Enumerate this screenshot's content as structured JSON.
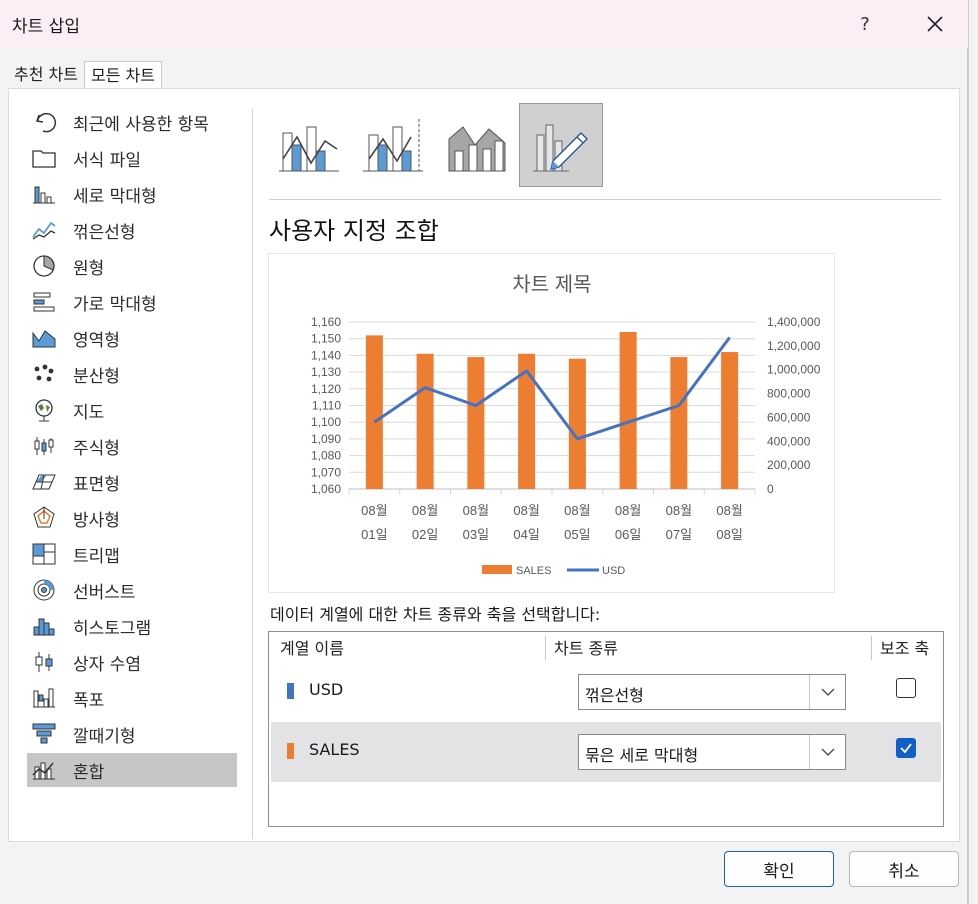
{
  "window": {
    "title": "차트 삽입",
    "help_label": "?"
  },
  "tabs": [
    {
      "label": "추천 차트"
    },
    {
      "label": "모든 차트"
    }
  ],
  "sidebar": {
    "items": [
      {
        "label": "최근에 사용한 항목",
        "icon": "recent-icon"
      },
      {
        "label": "서식 파일",
        "icon": "folder-icon"
      },
      {
        "label": "세로 막대형",
        "icon": "column-chart-icon"
      },
      {
        "label": "꺾은선형",
        "icon": "line-chart-icon"
      },
      {
        "label": "원형",
        "icon": "pie-chart-icon"
      },
      {
        "label": "가로 막대형",
        "icon": "bar-chart-icon"
      },
      {
        "label": "영역형",
        "icon": "area-chart-icon"
      },
      {
        "label": "분산형",
        "icon": "scatter-chart-icon"
      },
      {
        "label": "지도",
        "icon": "map-chart-icon"
      },
      {
        "label": "주식형",
        "icon": "stock-chart-icon"
      },
      {
        "label": "표면형",
        "icon": "surface-chart-icon"
      },
      {
        "label": "방사형",
        "icon": "radar-chart-icon"
      },
      {
        "label": "트리맵",
        "icon": "treemap-icon"
      },
      {
        "label": "선버스트",
        "icon": "sunburst-icon"
      },
      {
        "label": "히스토그램",
        "icon": "histogram-icon"
      },
      {
        "label": "상자 수염",
        "icon": "box-whisker-icon"
      },
      {
        "label": "폭포",
        "icon": "waterfall-icon"
      },
      {
        "label": "깔때기형",
        "icon": "funnel-icon"
      },
      {
        "label": "혼합",
        "icon": "combo-chart-icon",
        "selected": true
      }
    ]
  },
  "main": {
    "section_title": "사용자 지정 조합",
    "series_prompt": "데이터 계열에 대한 차트 종류와 축을 선택합니다:"
  },
  "chart_data": {
    "type": "bar",
    "title": "차트 제목",
    "categories": [
      [
        "08월",
        "01일"
      ],
      [
        "08월",
        "02일"
      ],
      [
        "08월",
        "03일"
      ],
      [
        "08월",
        "04일"
      ],
      [
        "08월",
        "05일"
      ],
      [
        "08월",
        "06일"
      ],
      [
        "08월",
        "07일"
      ],
      [
        "08월",
        "08일"
      ]
    ],
    "series": [
      {
        "name": "SALES",
        "type": "bar",
        "axis": "primary",
        "color": "#ED7D31",
        "values": [
          1152,
          1141,
          1139,
          1141,
          1138,
          1154,
          1139,
          1142
        ]
      },
      {
        "name": "USD",
        "type": "line",
        "axis": "secondary",
        "color": "#4472C4",
        "values": [
          560000,
          850000,
          700000,
          990000,
          420000,
          560000,
          700000,
          1270000
        ]
      }
    ],
    "y_primary": {
      "min": 1060,
      "max": 1160,
      "step": 10,
      "ticks": [
        "1,060",
        "1,070",
        "1,080",
        "1,090",
        "1,100",
        "1,110",
        "1,120",
        "1,130",
        "1,140",
        "1,150",
        "1,160"
      ]
    },
    "y_secondary": {
      "min": 0,
      "max": 1400000,
      "step": 200000,
      "ticks": [
        "0",
        "200,000",
        "400,000",
        "600,000",
        "800,000",
        "1,000,000",
        "1,200,000",
        "1,400,000"
      ]
    },
    "grid": true,
    "legend": "bottom"
  },
  "series_table": {
    "headers": {
      "name": "계열 이름",
      "type": "차트 종류",
      "secondary": "보조 축"
    },
    "rows": [
      {
        "name": "USD",
        "color": "#4472C4",
        "chart_type": "꺾은선형",
        "secondary": false
      },
      {
        "name": "SALES",
        "color": "#ED7D31",
        "chart_type": "묶은 세로 막대형",
        "secondary": true
      }
    ]
  },
  "buttons": {
    "ok": "확인",
    "cancel": "취소"
  }
}
